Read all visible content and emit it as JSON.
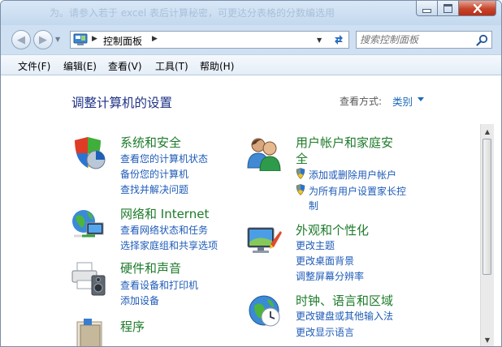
{
  "titlebar": {
    "faded_text": "为。请参入若于 excel 表后计算秘密，可更达分表格的分数编选用"
  },
  "address": {
    "path": "控制面板"
  },
  "search": {
    "placeholder": "搜索控制面板"
  },
  "menu": {
    "items": [
      "文件(F)",
      "编辑(E)",
      "查看(V)",
      "工具(T)",
      "帮助(H)"
    ]
  },
  "page": {
    "title": "调整计算机的设置",
    "view_by_label": "查看方式:",
    "view_by_value": "类别"
  },
  "categories": {
    "system": {
      "title": "系统和安全",
      "links": [
        "查看您的计算机状态",
        "备份您的计算机",
        "查找并解决问题"
      ]
    },
    "network": {
      "title": "网络和 Internet",
      "links": [
        "查看网络状态和任务",
        "选择家庭组和共享选项"
      ]
    },
    "hardware": {
      "title": "硬件和声音",
      "links": [
        "查看设备和打印机",
        "添加设备"
      ]
    },
    "programs": {
      "title": "程序"
    },
    "users": {
      "title_line1": "用户帐户和家庭安",
      "title_line2": "全",
      "links": [
        "添加或删除用户帐户",
        "为所有用户设置家长控",
        "制"
      ]
    },
    "appearance": {
      "title": "外观和个性化",
      "links": [
        "更改主题",
        "更改桌面背景",
        "调整屏幕分辨率"
      ]
    },
    "clock": {
      "title": "时钟、语言和区域",
      "links": [
        "更改键盘或其他输入法",
        "更改显示语言"
      ]
    }
  }
}
